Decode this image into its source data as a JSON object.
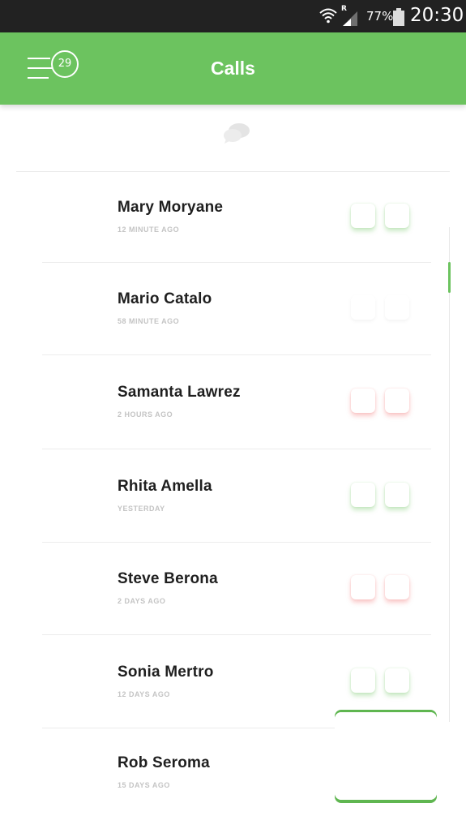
{
  "status_bar": {
    "roaming": "R",
    "battery": "77%",
    "time": "20:30"
  },
  "header": {
    "title": "Calls",
    "badge_count": "29"
  },
  "calls": [
    {
      "name": "Mary Moryane",
      "time": "12 MINUTE AGO",
      "action_color": "green"
    },
    {
      "name": "Mario Catalo",
      "time": "58 MINUTE AGO",
      "action_color": "plain"
    },
    {
      "name": "Samanta Lawrez",
      "time": "2 HOURS AGO",
      "action_color": "red"
    },
    {
      "name": "Rhita Amella",
      "time": "YESTERDAY",
      "action_color": "green"
    },
    {
      "name": "Steve Berona",
      "time": "2 DAYS AGO",
      "action_color": "red"
    },
    {
      "name": "Sonia Mertro",
      "time": "12 DAYS AGO",
      "action_color": "green"
    },
    {
      "name": "Rob Seroma",
      "time": "15 DAYS AGO",
      "action_color": "green"
    }
  ],
  "colors": {
    "accent": "#6cc35f",
    "status_bar": "#222222",
    "missed": "#f06e6e"
  }
}
